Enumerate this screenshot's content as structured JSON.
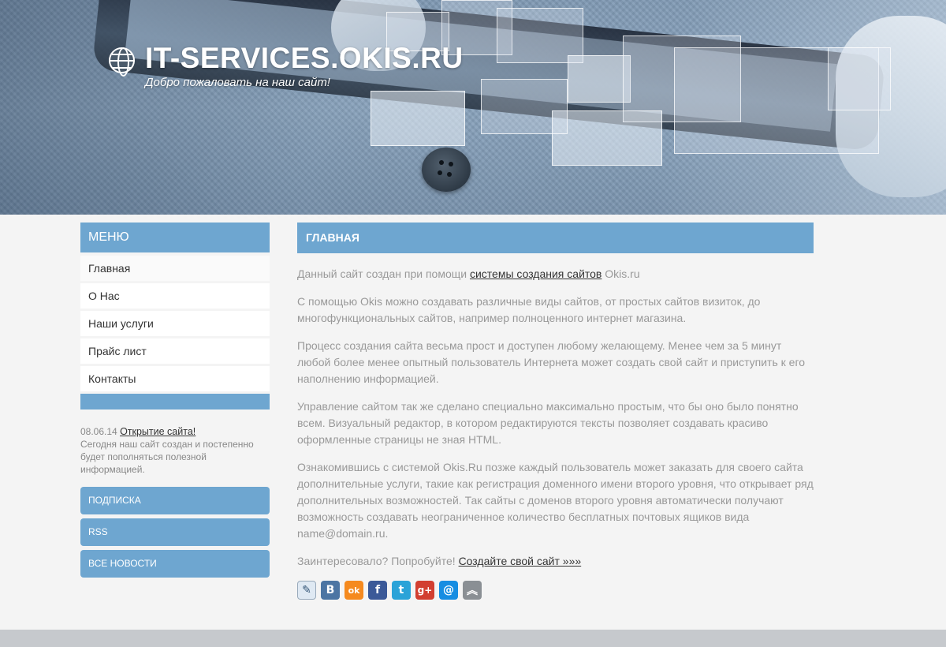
{
  "header": {
    "site_title": "IT-SERVICES.OKIS.RU",
    "slogan": "Добро пожаловать на наш сайт!"
  },
  "sidebar": {
    "menu_title": "МЕНЮ",
    "items": [
      {
        "label": "Главная"
      },
      {
        "label": "О Нас"
      },
      {
        "label": "Наши услуги"
      },
      {
        "label": "Прайс лист"
      },
      {
        "label": "Контакты"
      }
    ],
    "news": {
      "date": "08.06.14",
      "title": "Открытие сайта!",
      "text": "Сегодня наш сайт создан и постепенно будет пополняться полезной информацией."
    },
    "buttons": [
      {
        "label": "ПОДПИСКА"
      },
      {
        "label": "RSS"
      },
      {
        "label": "ВСЕ НОВОСТИ"
      }
    ]
  },
  "main": {
    "heading": "ГЛАВНАЯ",
    "p1_before": "Данный сайт создан при помощи ",
    "p1_link": "системы создания сайтов",
    "p1_after": " Okis.ru",
    "p2": "С помощью Okis можно создавать различные виды сайтов, от простых сайтов визиток, до многофункциональных сайтов, например полноценного интернет магазина.",
    "p3": "Процесс создания сайта весьма прост и доступен любому желающему. Менее чем за 5 минут любой более менее опытный пользователь Интернета может создать свой сайт и приступить к его наполнению информацией.",
    "p4": "Управление сайтом так же сделано специально максимально простым, что бы оно было понятно всем. Визуальный редактор, в котором редактируются тексты позволяет создавать красиво оформленные страницы не зная HTML.",
    "p5": "Ознакомившись с системой Okis.Ru позже каждый пользователь может заказать для своего сайта дополнительные услуги, такие как регистрация доменного имени второго уровня, что открывает ряд дополнительных возможностей. Так сайты с доменов второго уровня автоматически получают возможность создавать неограниченное количество бесплатных почтовых ящиков вида name@domain.ru.",
    "p6_before": "Заинтересовало? Попробуйте! ",
    "p6_link": "Создайте свой сайт »»»"
  },
  "share": [
    {
      "icon": "livejournal-icon",
      "glyph": "✎",
      "color": "#dfe9f3"
    },
    {
      "icon": "vkontakte-icon",
      "glyph": "B",
      "color": "#4c75a3"
    },
    {
      "icon": "odnoklassniki-icon",
      "glyph": "ok",
      "color": "#f58a1f"
    },
    {
      "icon": "facebook-icon",
      "glyph": "f",
      "color": "#3b5998"
    },
    {
      "icon": "twitter-icon",
      "glyph": "t",
      "color": "#2aa3d8"
    },
    {
      "icon": "google-plus-icon",
      "glyph": "g+",
      "color": "#d23f31"
    },
    {
      "icon": "mailru-icon",
      "glyph": "@",
      "color": "#168de2"
    },
    {
      "icon": "share-more-icon",
      "glyph": "︽",
      "color": "#8a8f94"
    }
  ]
}
